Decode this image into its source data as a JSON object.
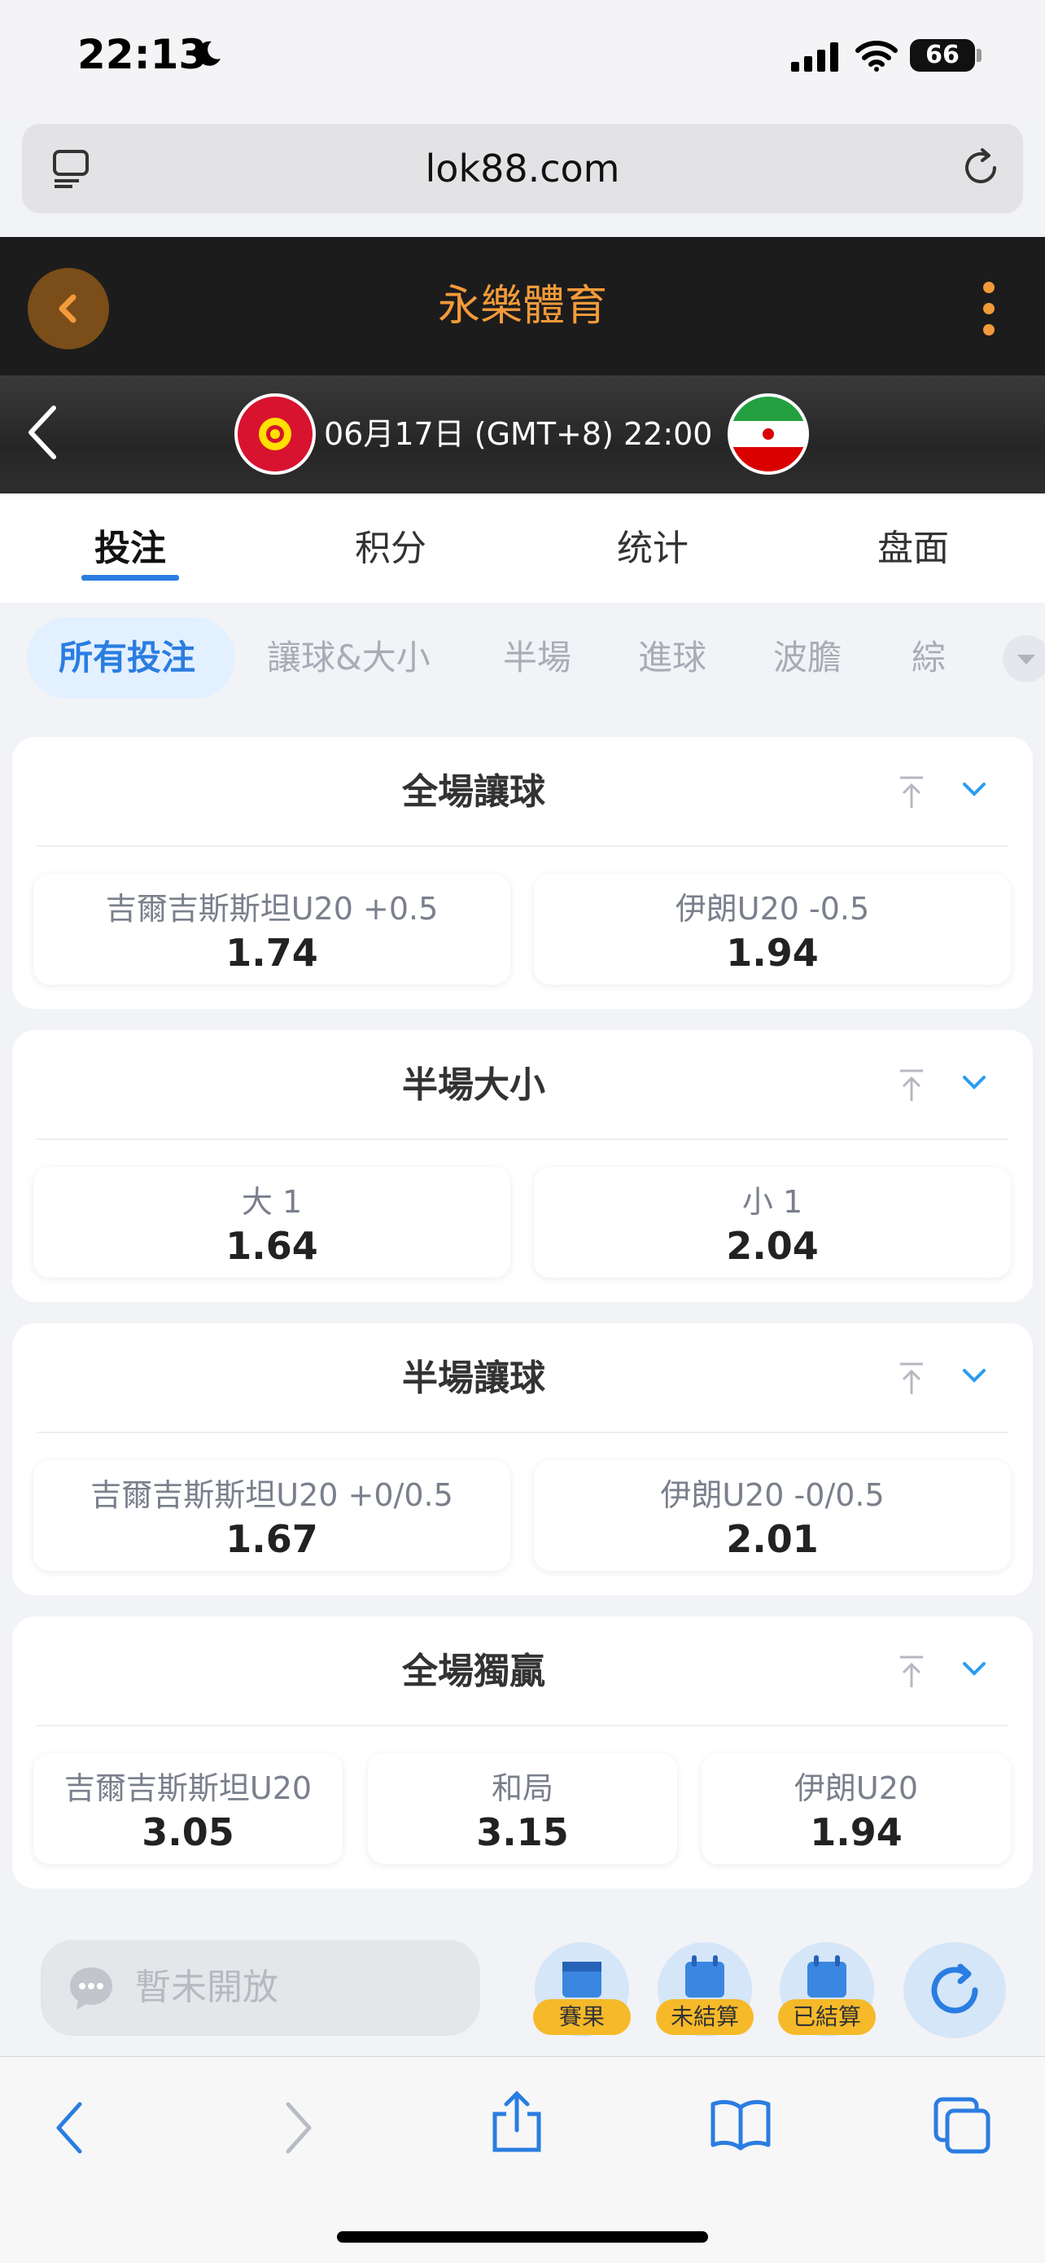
{
  "status_bar": {
    "time": "22:13",
    "battery": "66"
  },
  "browser": {
    "url": "lok88.com"
  },
  "app": {
    "title": "永樂體育"
  },
  "match": {
    "datetime": "06月17日 (GMT+8)  22:00"
  },
  "main_tabs": [
    "投注",
    "积分",
    "统计",
    "盘面"
  ],
  "sub_tabs": [
    "所有投注",
    "讓球&大小",
    "半場",
    "進球",
    "波膽",
    "綜"
  ],
  "markets": [
    {
      "title": "全場讓球",
      "options": [
        {
          "label": "吉爾吉斯斯坦U20 +0.5",
          "odds": "1.74"
        },
        {
          "label": "伊朗U20 -0.5",
          "odds": "1.94"
        }
      ]
    },
    {
      "title": "半場大小",
      "options": [
        {
          "label": "大 1",
          "odds": "1.64"
        },
        {
          "label": "小 1",
          "odds": "2.04"
        }
      ]
    },
    {
      "title": "半場讓球",
      "options": [
        {
          "label": "吉爾吉斯斯坦U20 +0/0.5",
          "odds": "1.67"
        },
        {
          "label": "伊朗U20 -0/0.5",
          "odds": "2.01"
        }
      ]
    },
    {
      "title": "全場獨贏",
      "options": [
        {
          "label": "吉爾吉斯斯坦U20",
          "odds": "3.05"
        },
        {
          "label": "和局",
          "odds": "3.15"
        },
        {
          "label": "伊朗U20",
          "odds": "1.94"
        }
      ]
    }
  ],
  "bottom_bar": {
    "chat_placeholder": "暫未開放",
    "buttons": [
      "賽果",
      "未結算",
      "已結算"
    ]
  },
  "colors": {
    "accent_orange": "#f39a3a",
    "accent_blue": "#2a7de1",
    "badge_yellow": "#f5b92a"
  }
}
